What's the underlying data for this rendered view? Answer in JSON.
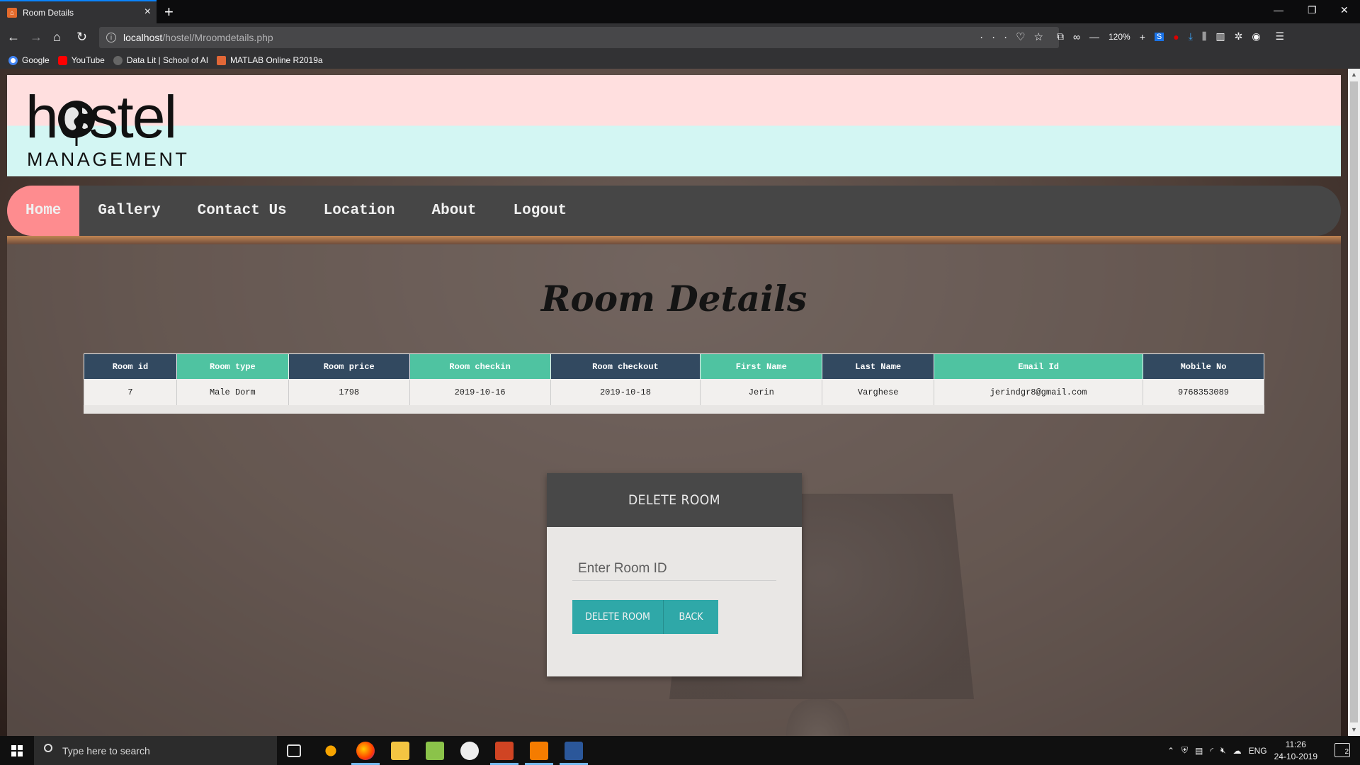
{
  "browser": {
    "tab_title": "Room Details",
    "url_host": "localhost",
    "url_path": "/hostel/Mroomdetails.php",
    "zoom": "120%",
    "bookmarks": [
      {
        "label": "Google",
        "color": "#4285f4"
      },
      {
        "label": "YouTube",
        "color": "#ff0000"
      },
      {
        "label": "Data Lit | School of AI",
        "color": "#666666"
      },
      {
        "label": "MATLAB Online R2019a",
        "color": "#e16737"
      }
    ]
  },
  "header": {
    "logo_word": "hostel",
    "logo_sub": "MANAGEMENT"
  },
  "menu": {
    "items": [
      {
        "label": "Home",
        "active": true
      },
      {
        "label": "Gallery"
      },
      {
        "label": "Contact Us"
      },
      {
        "label": "Location"
      },
      {
        "label": "About"
      },
      {
        "label": "Logout"
      }
    ]
  },
  "page": {
    "title": "Room Details"
  },
  "table": {
    "columns": [
      "Room id",
      "Room type",
      "Room price",
      "Room checkin",
      "Room checkout",
      "First Name",
      "Last Name",
      "Email Id",
      "Mobile No"
    ],
    "rows": [
      [
        "7",
        "Male Dorm",
        "1798",
        "2019-10-16",
        "2019-10-18",
        "Jerin",
        "Varghese",
        "jerindgr8@gmail.com",
        "9768353089"
      ]
    ]
  },
  "delete_form": {
    "heading": "DELETE ROOM",
    "input_placeholder": "Enter Room ID",
    "delete_button": "DELETE ROOM",
    "back_button": "BACK"
  },
  "taskbar": {
    "search_placeholder": "Type here to search",
    "language": "ENG",
    "time": "11:26",
    "date": "24-10-2019",
    "notifications": "2"
  },
  "colors": {
    "menu_active": "#fe8c8f",
    "table_header_dark": "#324960",
    "table_header_teal": "#4fc3a1",
    "button": "#2fa8a8"
  }
}
